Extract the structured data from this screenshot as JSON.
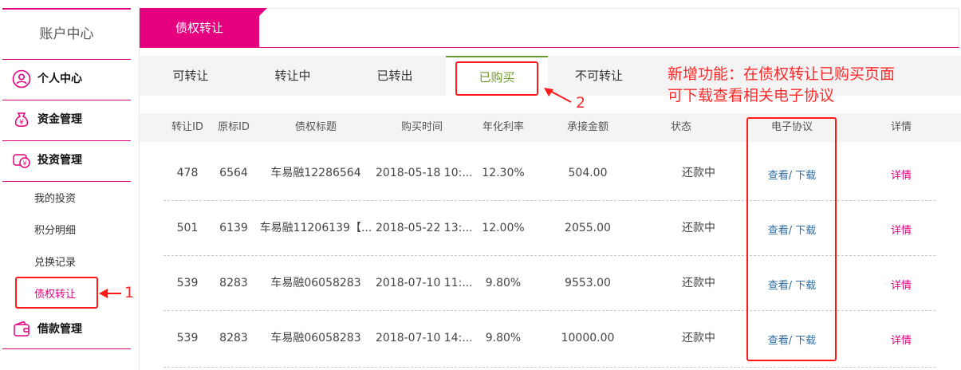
{
  "sidebar": {
    "title": "账户中心",
    "sections": [
      {
        "label": "个人中心",
        "icon": "user-icon"
      },
      {
        "label": "资金管理",
        "icon": "money-icon"
      },
      {
        "label": "投资管理",
        "icon": "invest-icon"
      },
      {
        "label": "借款管理",
        "icon": "wallet-icon"
      }
    ],
    "sub_items": [
      "我的投资",
      "积分明细",
      "兑换记录",
      "债权转让"
    ],
    "active_sub": "债权转让"
  },
  "main": {
    "tab_title": "债权转让",
    "subtabs": [
      "可转让",
      "转让中",
      "已转出",
      "已购买",
      "不可转让"
    ],
    "active_subtab": "已购买"
  },
  "table": {
    "headers": [
      "转让ID",
      "原标ID",
      "债权标题",
      "购买时间",
      "年化利率",
      "承接金额",
      "状态",
      "电子协议",
      "详情"
    ],
    "rows": [
      {
        "id": "478",
        "orig_id": "6564",
        "title": "车易融12286564",
        "time": "2018-05-18 10:...",
        "rate": "12.30%",
        "amount": "504.00",
        "status": "还款中",
        "agreement": "查看/ 下载",
        "detail": "详情"
      },
      {
        "id": "501",
        "orig_id": "6139",
        "title": "车易融11206139【...",
        "time": "2018-05-22 13:...",
        "rate": "12.00%",
        "amount": "2055.00",
        "status": "还款中",
        "agreement": "查看/ 下载",
        "detail": "详情"
      },
      {
        "id": "539",
        "orig_id": "8283",
        "title": "车易融06058283",
        "time": "2018-07-10 11:...",
        "rate": "9.80%",
        "amount": "9553.00",
        "status": "还款中",
        "agreement": "查看/ 下载",
        "detail": "详情"
      },
      {
        "id": "539",
        "orig_id": "8283",
        "title": "车易融06058283",
        "time": "2018-07-10 14:...",
        "rate": "9.80%",
        "amount": "10000.00",
        "status": "还款中",
        "agreement": "查看/ 下载",
        "detail": "详情"
      }
    ]
  },
  "annotation": {
    "line1": "新增功能：在债权转让已购买页面",
    "line2": "可下载查看相关电子协议",
    "marker1": "1",
    "marker2": "2"
  },
  "colors": {
    "accent": "#e4007f",
    "active_tab": "#6f9a2c",
    "link": "#2e6da4",
    "annotation": "#ff1a1a"
  }
}
